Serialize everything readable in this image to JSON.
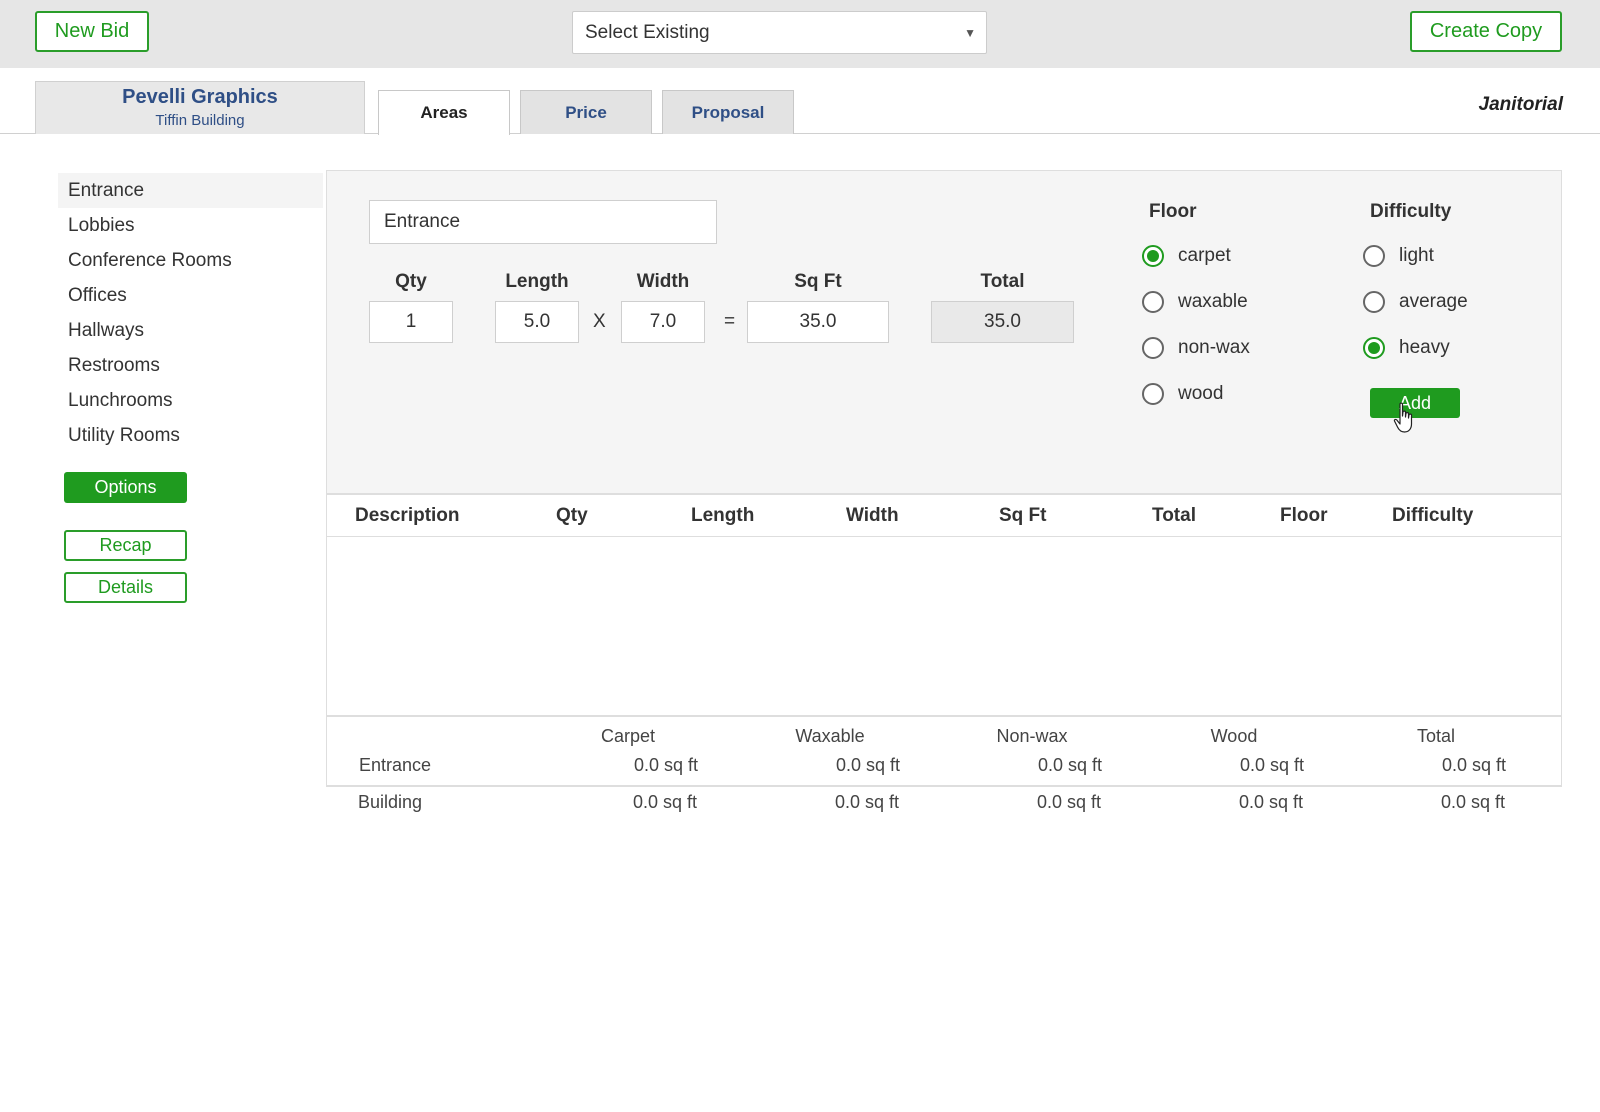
{
  "toolbar": {
    "new_bid_label": "New Bid",
    "select_existing": "Select Existing",
    "create_copy_label": "Create Copy"
  },
  "client": {
    "name": "Pevelli Graphics",
    "building": "Tiffin Building"
  },
  "tabs": [
    {
      "label": "Areas",
      "active": true
    },
    {
      "label": "Price",
      "active": false
    },
    {
      "label": "Proposal",
      "active": false
    }
  ],
  "service_type": "Janitorial",
  "sidebar": {
    "items": [
      {
        "label": "Entrance",
        "active": true
      },
      {
        "label": "Lobbies"
      },
      {
        "label": "Conference Rooms"
      },
      {
        "label": "Offices"
      },
      {
        "label": "Hallways"
      },
      {
        "label": "Restrooms"
      },
      {
        "label": "Lunchrooms"
      },
      {
        "label": "Utility Rooms"
      }
    ],
    "options_label": "Options",
    "recap_label": "Recap",
    "details_label": "Details"
  },
  "form": {
    "description_value": "Entrance",
    "headers": {
      "qty": "Qty",
      "length": "Length",
      "width": "Width",
      "sqft": "Sq Ft",
      "total": "Total"
    },
    "qty": "1",
    "length": "5.0",
    "times": "X",
    "width": "7.0",
    "equals": "=",
    "sqft": "35.0",
    "total": "35.0",
    "floor_title": "Floor",
    "floor_options": [
      {
        "label": "carpet",
        "checked": true
      },
      {
        "label": "waxable",
        "checked": false
      },
      {
        "label": "non-wax",
        "checked": false
      },
      {
        "label": "wood",
        "checked": false
      }
    ],
    "difficulty_title": "Difficulty",
    "difficulty_options": [
      {
        "label": "light",
        "checked": false
      },
      {
        "label": "average",
        "checked": false
      },
      {
        "label": "heavy",
        "checked": true
      }
    ],
    "add_label": "Add"
  },
  "table": {
    "columns": [
      "Description",
      "Qty",
      "Length",
      "Width",
      "Sq Ft",
      "Total",
      "Floor",
      "Difficulty"
    ],
    "rows": []
  },
  "summary": {
    "columns": [
      "Carpet",
      "Waxable",
      "Non-wax",
      "Wood",
      "Total"
    ],
    "rows": [
      {
        "label": "Entrance",
        "values": [
          "0.0 sq ft",
          "0.0 sq ft",
          "0.0 sq ft",
          "0.0 sq ft",
          "0.0 sq ft"
        ]
      },
      {
        "label": "Building",
        "values": [
          "0.0 sq ft",
          "0.0 sq ft",
          "0.0 sq ft",
          "0.0 sq ft",
          "0.0 sq ft"
        ]
      }
    ]
  },
  "colors": {
    "accent_green": "#1f9b1f",
    "link_blue": "#2f4f86",
    "topbar_gray": "#e6e6e6"
  }
}
